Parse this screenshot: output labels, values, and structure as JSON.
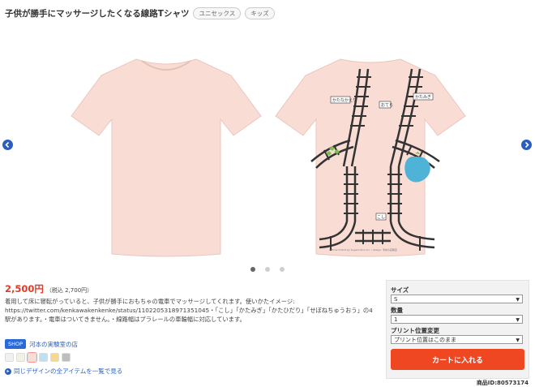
{
  "header": {
    "title": "子供が勝手にマッサージしたくなる線路Tシャツ",
    "tags": [
      "ユニセックス",
      "キッズ"
    ]
  },
  "carousel": {
    "left_icon": "chevron-left-icon",
    "right_icon": "chevron-right-icon",
    "dot_count": 3,
    "active_dot": 1,
    "shirt_color": "#f9ddd5",
    "back_print": {
      "station_signs": [
        "かたなかえり",
        "おてら",
        "かたみぎ",
        "こし"
      ],
      "caption": "Official T-Shirt by Sugamotion Inc. / design: 河本の実験室"
    }
  },
  "product": {
    "price": "2,500円",
    "price_tax": "（税込 2,700円）",
    "description": "着用して床に寝転がっていると、子供が勝手におもちゃの電車でマッサージしてくれます。使いかたイメージ: https://twitter.com/kenkawakenkenke/status/1102205318971351045・「こし」「かたみぎ」「かたひだり」「せぼねちゅうおう」の4駅があります。・電車はついてきません。・線路幅はプラレールの車輪幅に対応しています。"
  },
  "shop": {
    "badge": "SHOP",
    "name": "河本の実験室の店"
  },
  "swatches": [
    {
      "color": "#f1f1f1"
    },
    {
      "color": "#f5f0e4"
    },
    {
      "color": "#f9ddd5"
    },
    {
      "color": "#bfe0f2"
    },
    {
      "color": "#f5d98f"
    },
    {
      "color": "#bdbdbd"
    }
  ],
  "selected_swatch": 2,
  "same_design_link": "同じデザインの全アイテムを一覧で見る",
  "purchase_panel": {
    "size_label": "サイズ",
    "size_value": "S",
    "qty_label": "数量",
    "qty_value": "1",
    "print_label": "プリント位置変更",
    "print_value": "プリント位置はこのまま",
    "cart_button": "カートに入れる"
  },
  "product_id": "商品ID:80573174",
  "colors": {
    "accent_red": "#e23a2a",
    "cart_orange": "#f04723",
    "link_blue": "#2a5fc0"
  }
}
